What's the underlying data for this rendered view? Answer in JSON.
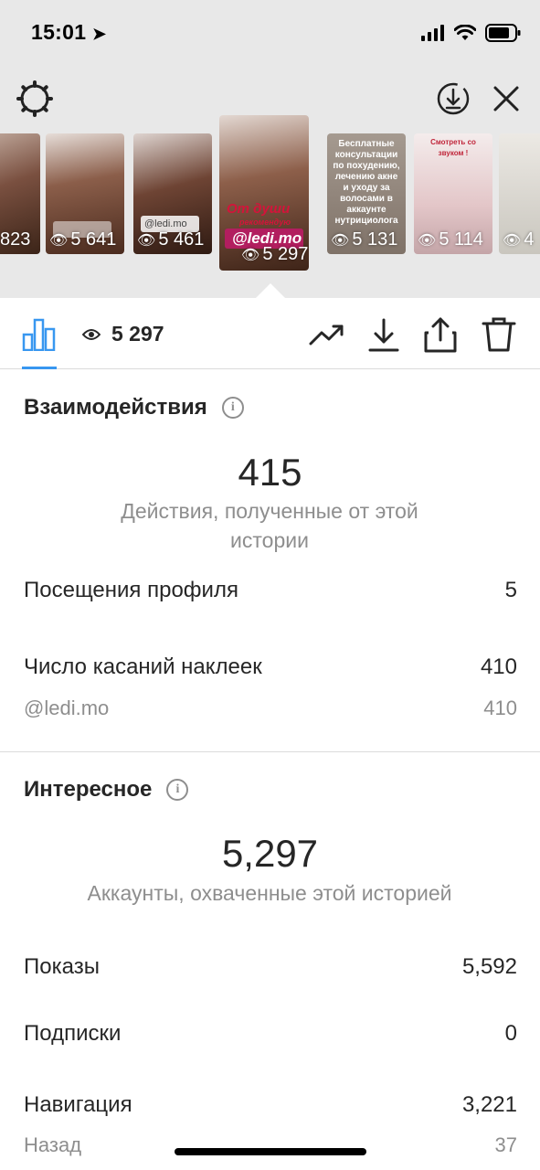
{
  "status_bar": {
    "time": "15:01"
  },
  "stories": [
    {
      "views": "823",
      "selected": false
    },
    {
      "views": "5 641",
      "selected": false
    },
    {
      "views": "5 461",
      "tag": "@ledi.mo",
      "selected": false
    },
    {
      "views": "5 297",
      "selected": true,
      "title": "От души",
      "subtitle": "рекомендую",
      "handle": "@ledi.mo"
    },
    {
      "views": "5 131",
      "caption": "Бесплатные консультации по похудению, лечению акне и уходу за волосами в аккаунте нутрициолога",
      "selected": false
    },
    {
      "views": "5 114",
      "caption": "Смотреть со звуком !",
      "selected": false
    },
    {
      "views": "4",
      "selected": false
    }
  ],
  "toolbar": {
    "views": "5 297"
  },
  "interactions": {
    "title": "Взаимодействия",
    "total": "415",
    "caption": "Действия, полученные от этой истории",
    "rows": [
      {
        "label": "Посещения профиля",
        "value": "5"
      },
      {
        "label": "Число касаний наклеек",
        "value": "410"
      }
    ],
    "sub_rows": [
      {
        "label": "@ledi.mo",
        "value": "410"
      }
    ]
  },
  "discovery": {
    "title": "Интересное",
    "total": "5,297",
    "caption": "Аккаунты, охваченные этой историей",
    "rows": [
      {
        "label": "Показы",
        "value": "5,592"
      },
      {
        "label": "Подписки",
        "value": "0"
      },
      {
        "label": "Навигация",
        "value": "3,221"
      }
    ],
    "sub_rows": [
      {
        "label": "Назад",
        "value": "37"
      }
    ]
  },
  "colors": {
    "accent": "#3897f0",
    "muted": "#8e8e8e",
    "text": "#262626",
    "sticker_red": "#d3143a"
  }
}
